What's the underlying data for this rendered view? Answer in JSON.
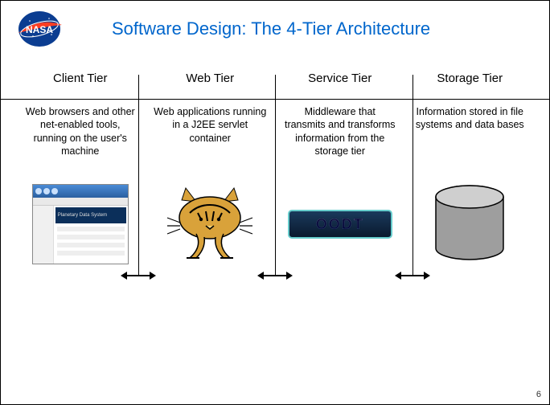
{
  "title": "Software Design: The 4-Tier Architecture",
  "tiers": [
    {
      "name": "Client Tier",
      "desc": "Web browsers and other net-enabled tools, running on the user's machine",
      "icon": "browser"
    },
    {
      "name": "Web Tier",
      "desc": "Web applications running in a J2EE servlet container",
      "icon": "tomcat"
    },
    {
      "name": "Service Tier",
      "desc": "Middleware that transmits and transforms information from the storage tier",
      "icon": "oodt"
    },
    {
      "name": "Storage Tier",
      "desc": "Information stored in file systems and data bases",
      "icon": "cylinder"
    }
  ],
  "oodt_label": "OODT",
  "browser_banner": "Planetary Data System",
  "page_number": "6",
  "logo_text": "NASA"
}
